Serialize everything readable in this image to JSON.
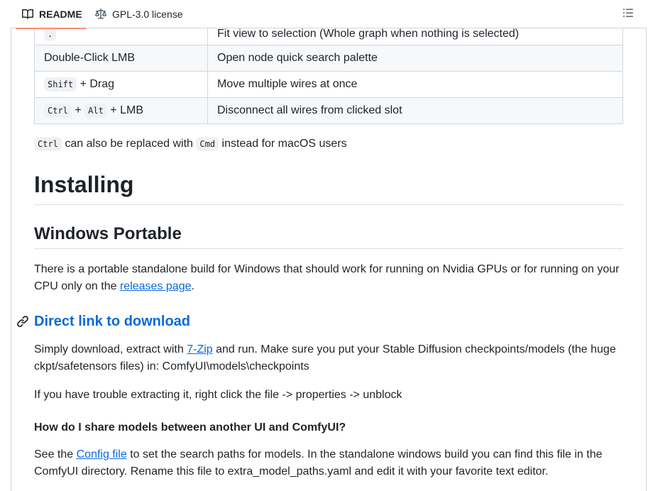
{
  "tabs": {
    "readme": "README",
    "license": "GPL-3.0 license"
  },
  "shortcuts": [
    {
      "keys": [
        "."
      ],
      "joiners": [],
      "suffix": "",
      "action": "Fit view to selection (Whole graph when nothing is selected)"
    },
    {
      "keys": [],
      "joiners": [],
      "suffix": "Double-Click LMB",
      "action": "Open node quick search palette"
    },
    {
      "keys": [
        "Shift"
      ],
      "joiners": [],
      "suffix": "+ Drag",
      "action": "Move multiple wires at once"
    },
    {
      "keys": [
        "Ctrl",
        "Alt"
      ],
      "joiners": [
        "+"
      ],
      "suffix": "+ LMB",
      "action": "Disconnect all wires from clicked slot"
    }
  ],
  "note": {
    "key1": "Ctrl",
    "text1": "can also be replaced with",
    "key2": "Cmd",
    "text2": "instead for macOS users"
  },
  "headings": {
    "installing": "Installing",
    "windows_portable": "Windows Portable",
    "direct_link": "Direct link to download",
    "share_models": "How do I share models between another UI and ComfyUI?"
  },
  "paragraphs": {
    "portable_before": "There is a portable standalone build for Windows that should work for running on Nvidia GPUs or for running on your CPU only on the",
    "portable_link": "releases page",
    "portable_after": ".",
    "download_before": "Simply download, extract with",
    "download_link": "7-Zip",
    "download_after": "and run. Make sure you put your Stable Diffusion checkpoints/models (the huge ckpt/safetensors files) in: ComfyUI\\models\\checkpoints",
    "trouble": "If you have trouble extracting it, right click the file -> properties -> unblock",
    "config_before": "See the",
    "config_link": "Config file",
    "config_after": "to set the search paths for models. In the standalone windows build you can find this file in the ComfyUI directory. Rename this file to extra_model_paths.yaml and edit it with your favorite text editor."
  }
}
